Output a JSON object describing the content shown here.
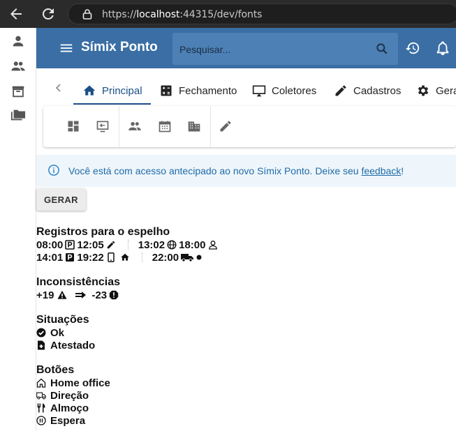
{
  "browser": {
    "url_scheme": "https://",
    "url_host": "localhost",
    "url_rest": ":44315/dev/fonts"
  },
  "app": {
    "title": "Símix Ponto",
    "search_placeholder": "Pesquisar...",
    "accent": "#3a6ea5"
  },
  "tabs": [
    {
      "label": "Principal",
      "icon": "home-icon",
      "active": true
    },
    {
      "label": "Fechamento",
      "icon": "calculator-icon"
    },
    {
      "label": "Coletores",
      "icon": "monitor-icon"
    },
    {
      "label": "Cadastros",
      "icon": "pencil-icon"
    },
    {
      "label": "Gera",
      "icon": "gear-icon"
    }
  ],
  "banner": {
    "text_before": "Você está com acesso antecipado ao novo Símix Ponto. Deixe seu ",
    "link": "feedback",
    "text_after": "!"
  },
  "gerar_label": "GERAR",
  "registros": {
    "title": "Registros para o espelho",
    "row1": [
      "08:00",
      "12:05",
      "13:02",
      "18:00"
    ],
    "row2": [
      "14:01",
      "19:22",
      "22:00"
    ]
  },
  "inconsistencias": {
    "title": "Inconsistências",
    "plus": "+19",
    "minus": "-23"
  },
  "situacoes": {
    "title": "Situações",
    "items": [
      "Ok",
      "Atestado"
    ]
  },
  "botoes": {
    "title": "Botões",
    "items": [
      "Home office",
      "Direção",
      "Almoço",
      "Espera"
    ]
  }
}
